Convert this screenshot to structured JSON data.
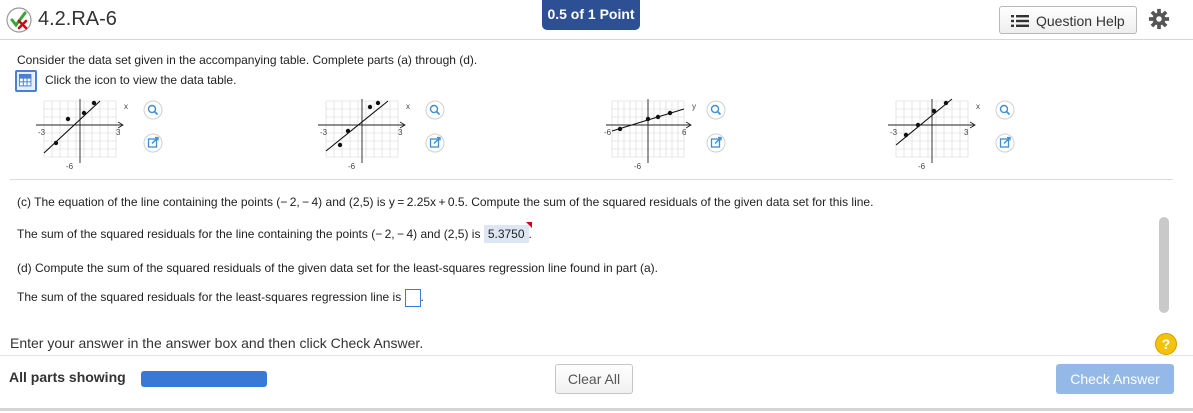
{
  "header": {
    "title": "4.2.RA-6",
    "score": "0.5 of 1 Point",
    "help_label": "Question Help",
    "status_icon": "partially-correct-icon",
    "colors": {
      "badge": "#2d4f93",
      "status_green": "#3aa33a",
      "status_red": "#d0021b"
    }
  },
  "intro": {
    "text": "Consider the data set given in the accompanying table. Complete parts (a) through (d).",
    "table_link": "Click the icon to view the data table."
  },
  "graphs": [
    {
      "axis_var": "x",
      "x_min_label": "-3",
      "x_max_label": "3",
      "y_min_label": "-6"
    },
    {
      "axis_var": "x",
      "x_min_label": "-3",
      "x_max_label": "3",
      "y_min_label": "-6"
    },
    {
      "axis_var": "y",
      "x_min_label": "-6",
      "x_max_label": "6",
      "y_min_label": "-6"
    },
    {
      "axis_var": "x",
      "x_min_label": "-3",
      "x_max_label": "3",
      "y_min_label": "-6"
    }
  ],
  "part_c": {
    "question": "(c) The equation of the line containing the points (− 2, − 4) and (2,5) is y = 2.25x + 0.5. Compute the sum of the squared residuals of the given data set for this line.",
    "answer_prefix": "The sum of the squared residuals for the line containing the points (− 2, − 4) and (2,5) is",
    "answer_value": "5.3750",
    "answer_suffix": "."
  },
  "part_d": {
    "question": "(d) Compute the sum of the squared residuals of the given data set for the least-squares regression line found in part (a).",
    "answer_prefix": "The sum of the squared residuals for the least-squares regression line is",
    "answer_suffix": "."
  },
  "footer": {
    "instruction": "Enter your answer in the answer box and then click Check Answer.",
    "parts_label": "All parts showing",
    "progress_fraction": 1.0,
    "clear_label": "Clear All",
    "check_label": "Check Answer"
  }
}
